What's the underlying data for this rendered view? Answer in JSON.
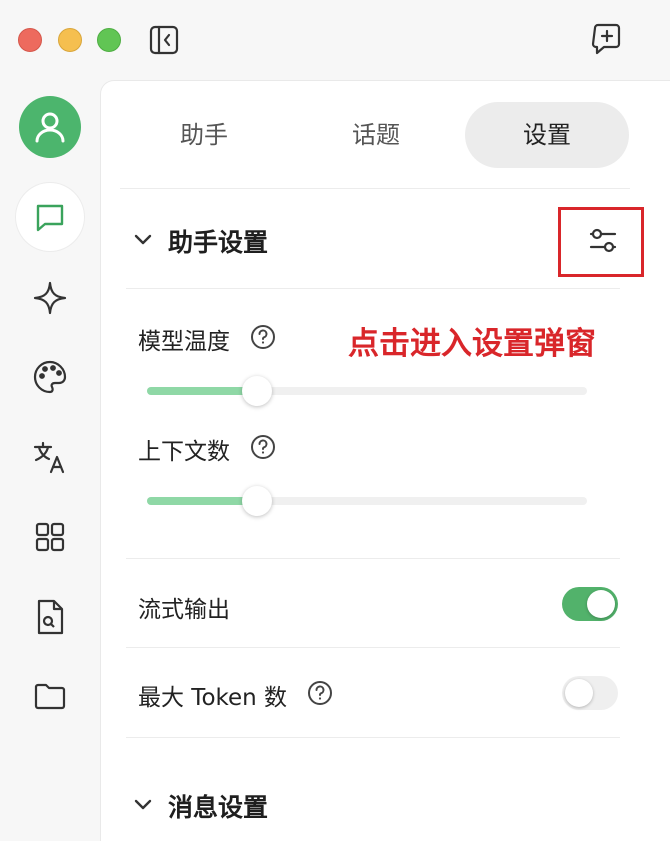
{
  "window": {
    "controls": [
      "close",
      "minimize",
      "maximize"
    ],
    "toolbar_icons": [
      "sidebar-toggle-icon",
      "new-topic-icon"
    ]
  },
  "sidebar": {
    "items": [
      {
        "name": "avatar",
        "icon": "user-icon",
        "active": false
      },
      {
        "name": "chat",
        "icon": "chat-icon",
        "active": true
      },
      {
        "name": "agents",
        "icon": "sparkle-icon",
        "active": false
      },
      {
        "name": "paintings",
        "icon": "palette-icon",
        "active": false
      },
      {
        "name": "translate",
        "icon": "translate-icon",
        "active": false
      },
      {
        "name": "apps",
        "icon": "apps-grid-icon",
        "active": false
      },
      {
        "name": "knowledge",
        "icon": "file-search-icon",
        "active": false
      },
      {
        "name": "files",
        "icon": "folder-icon",
        "active": false
      }
    ]
  },
  "tabs": [
    {
      "label": "助手"
    },
    {
      "label": "话题"
    },
    {
      "label": "设置"
    }
  ],
  "active_tab": "设置",
  "assistant_settings": {
    "title": "助手设置",
    "settings_icon": "sliders-icon",
    "temperature": {
      "label": "模型温度",
      "value": 0.25
    },
    "context_count": {
      "label": "上下文数",
      "value": 0.25
    },
    "stream_output": {
      "label": "流式输出",
      "on": true
    },
    "max_tokens": {
      "label": "最大 Token 数",
      "on": false
    }
  },
  "message_settings": {
    "title": "消息设置"
  },
  "annotation": {
    "text": "点击进入设置弹窗",
    "color": "#d9262a"
  },
  "colors": {
    "accent": "#52b26b",
    "avatar": "#4cb56d",
    "slider_fill": "#8fd8a6"
  }
}
